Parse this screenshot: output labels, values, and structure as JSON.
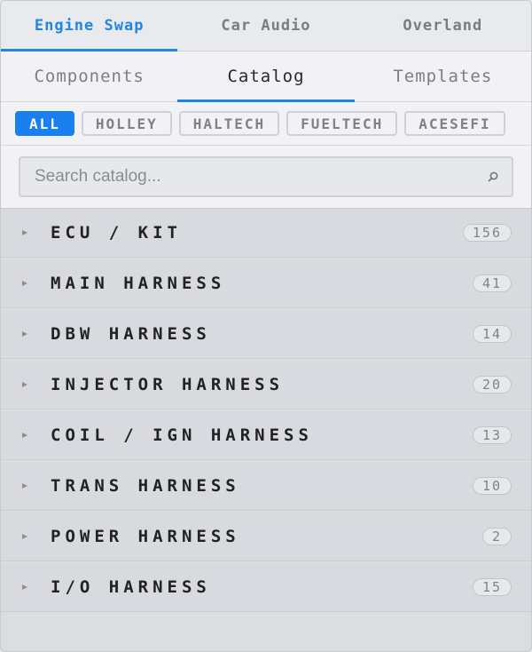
{
  "tabs": [
    {
      "label": "Engine Swap",
      "active": true
    },
    {
      "label": "Car Audio",
      "active": false
    },
    {
      "label": "Overland",
      "active": false
    }
  ],
  "subtabs": [
    {
      "label": "Components",
      "active": false
    },
    {
      "label": "Catalog",
      "active": true
    },
    {
      "label": "Templates",
      "active": false
    }
  ],
  "filters": [
    {
      "label": "ALL",
      "active": true
    },
    {
      "label": "HOLLEY",
      "active": false
    },
    {
      "label": "HALTECH",
      "active": false
    },
    {
      "label": "FUELTECH",
      "active": false
    },
    {
      "label": "ACESEFI",
      "active": false
    }
  ],
  "search": {
    "placeholder": "Search catalog...",
    "value": "",
    "icon": "search-icon"
  },
  "categories": [
    {
      "label": "ECU / KIT",
      "count": "156"
    },
    {
      "label": "MAIN HARNESS",
      "count": "41"
    },
    {
      "label": "DBW HARNESS",
      "count": "14"
    },
    {
      "label": "INJECTOR HARNESS",
      "count": "20"
    },
    {
      "label": "COIL / IGN HARNESS",
      "count": "13"
    },
    {
      "label": "TRANS HARNESS",
      "count": "10"
    },
    {
      "label": "POWER HARNESS",
      "count": "2"
    },
    {
      "label": "I/O HARNESS",
      "count": "15"
    }
  ],
  "colors": {
    "accent": "#1f86e6",
    "chip_active": "#1a80f0",
    "row_bg": "#d9dadf"
  }
}
